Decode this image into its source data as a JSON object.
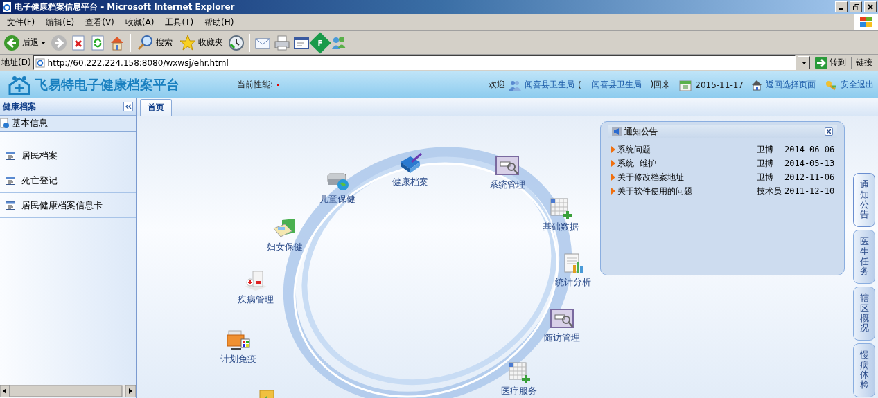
{
  "window": {
    "title": "电子健康档案信息平台 - Microsoft Internet Explorer"
  },
  "menu": [
    "文件(F)",
    "编辑(E)",
    "查看(V)",
    "收藏(A)",
    "工具(T)",
    "帮助(H)"
  ],
  "toolbar": [
    {
      "kind": "back",
      "label": "后退"
    },
    {
      "kind": "forward"
    },
    {
      "kind": "stop"
    },
    {
      "kind": "refresh"
    },
    {
      "kind": "home"
    },
    {
      "kind": "search",
      "label": "搜索"
    },
    {
      "kind": "favorites",
      "label": "收藏夹"
    },
    {
      "kind": "history"
    },
    {
      "kind": "mail"
    },
    {
      "kind": "print"
    },
    {
      "kind": "edit"
    },
    {
      "kind": "diamond",
      "label": "F"
    },
    {
      "kind": "messenger"
    }
  ],
  "address": {
    "label": "地址(D)",
    "value": "http://60.222.224.158:8080/wxwsj/ehr.html",
    "go": "转到",
    "links": "链接"
  },
  "header": {
    "logo": "飞易特电子健康档案平台",
    "performance": "当前性能:",
    "welcome": "欢迎",
    "user": "闻喜县卫生局",
    "paren_open": "(",
    "org": "闻喜县卫生局",
    "paren_close": ")回来",
    "date": "2015-11-17",
    "back_link": "返回选择页面",
    "logout": "安全退出"
  },
  "sidebar": {
    "title": "健康档案",
    "section": "基本信息",
    "items": [
      "居民档案",
      "死亡登记",
      "居民健康档案信息卡"
    ]
  },
  "tabs": [
    {
      "label": "首页",
      "selected": true
    }
  ],
  "modules": [
    {
      "label": "儿童保健",
      "kind": "drive"
    },
    {
      "label": "健康档案",
      "kind": "book"
    },
    {
      "label": "系统管理",
      "kind": "window"
    },
    {
      "label": "基础数据",
      "kind": "grid"
    },
    {
      "label": "妇女保健",
      "kind": "calc"
    },
    {
      "label": "统计分析",
      "kind": "chart"
    },
    {
      "label": "疾病管理",
      "kind": "hospital"
    },
    {
      "label": "随访管理",
      "kind": "window"
    },
    {
      "label": "计划免疫",
      "kind": "folder"
    },
    {
      "label": "医疗服务",
      "kind": "grid"
    },
    {
      "kind": "return"
    }
  ],
  "notice": {
    "title": "通知公告",
    "items": [
      {
        "title": "系统问题",
        "author": "卫博",
        "date": "2014-06-06"
      },
      {
        "title": "系统  维护",
        "author": "卫搏",
        "date": "2014-05-13"
      },
      {
        "title": "关于修改档案地址",
        "author": "卫博",
        "date": "2012-11-06"
      },
      {
        "title": "关于软件使用的问题",
        "author": "技术员",
        "date": "2011-12-10"
      }
    ]
  },
  "side_tabs": [
    {
      "label": "通知公告",
      "selected": true
    },
    {
      "label": "医生任务",
      "selected": false
    },
    {
      "label": "辖区概况",
      "selected": false
    },
    {
      "label": "慢病体检",
      "selected": false
    }
  ]
}
